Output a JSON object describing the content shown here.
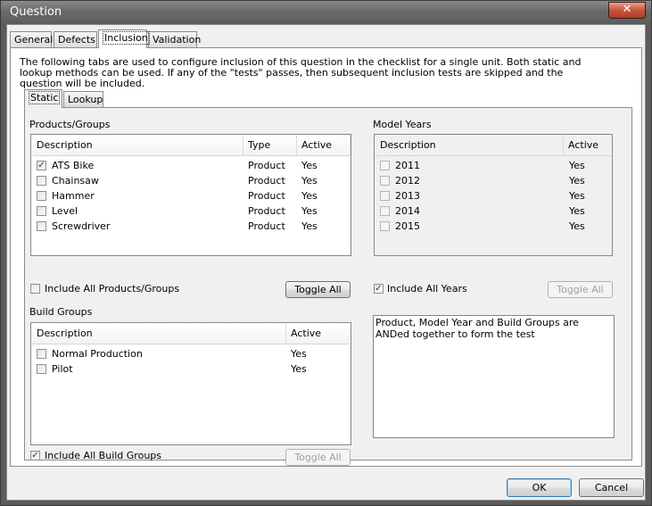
{
  "window": {
    "title": "Question",
    "close_glyph": "✕"
  },
  "main_tabs": [
    {
      "label": "General"
    },
    {
      "label": "Defects"
    },
    {
      "label": "Inclusion"
    },
    {
      "label": "Validation"
    }
  ],
  "intro_text": "The following tabs are used to configure inclusion of this question in the checklist for a single unit. Both static and lookup methods can be used. If any of the \"tests\" passes, then subsequent inclusion tests are skipped and the question will be included.",
  "sub_tabs": [
    {
      "label": "Static"
    },
    {
      "label": "Lookup"
    }
  ],
  "products": {
    "title": "Products/Groups",
    "columns": [
      "Description",
      "Type",
      "Active"
    ],
    "rows": [
      {
        "description": "ATS Bike",
        "type": "Product",
        "active": "Yes",
        "checked": true
      },
      {
        "description": "Chainsaw",
        "type": "Product",
        "active": "Yes",
        "checked": false
      },
      {
        "description": "Hammer",
        "type": "Product",
        "active": "Yes",
        "checked": false
      },
      {
        "description": "Level",
        "type": "Product",
        "active": "Yes",
        "checked": false
      },
      {
        "description": "Screwdriver",
        "type": "Product",
        "active": "Yes",
        "checked": false
      }
    ],
    "include_all_label": "Include All Products/Groups",
    "include_all_checked": false,
    "toggle_label": "Toggle All"
  },
  "model_years": {
    "title": "Model Years",
    "columns": [
      "Description",
      "Active"
    ],
    "rows": [
      {
        "description": "2011",
        "active": "Yes",
        "checked": false
      },
      {
        "description": "2012",
        "active": "Yes",
        "checked": false
      },
      {
        "description": "2013",
        "active": "Yes",
        "checked": false
      },
      {
        "description": "2014",
        "active": "Yes",
        "checked": false
      },
      {
        "description": "2015",
        "active": "Yes",
        "checked": false
      }
    ],
    "include_all_label": "Include All Years",
    "include_all_checked": true,
    "toggle_label": "Toggle All"
  },
  "build_groups": {
    "title": "Build Groups",
    "columns": [
      "Description",
      "Active"
    ],
    "rows": [
      {
        "description": "Normal Production",
        "active": "Yes",
        "checked": false
      },
      {
        "description": "Pilot",
        "active": "Yes",
        "checked": false
      }
    ],
    "include_all_label": "Include All Build Groups",
    "include_all_checked": true,
    "toggle_label": "Toggle All"
  },
  "note_text": "Product, Model Year and Build Groups are ANDed together to form the test",
  "footer": {
    "ok_label": "OK",
    "cancel_label": "Cancel"
  },
  "check_glyph": "✓"
}
